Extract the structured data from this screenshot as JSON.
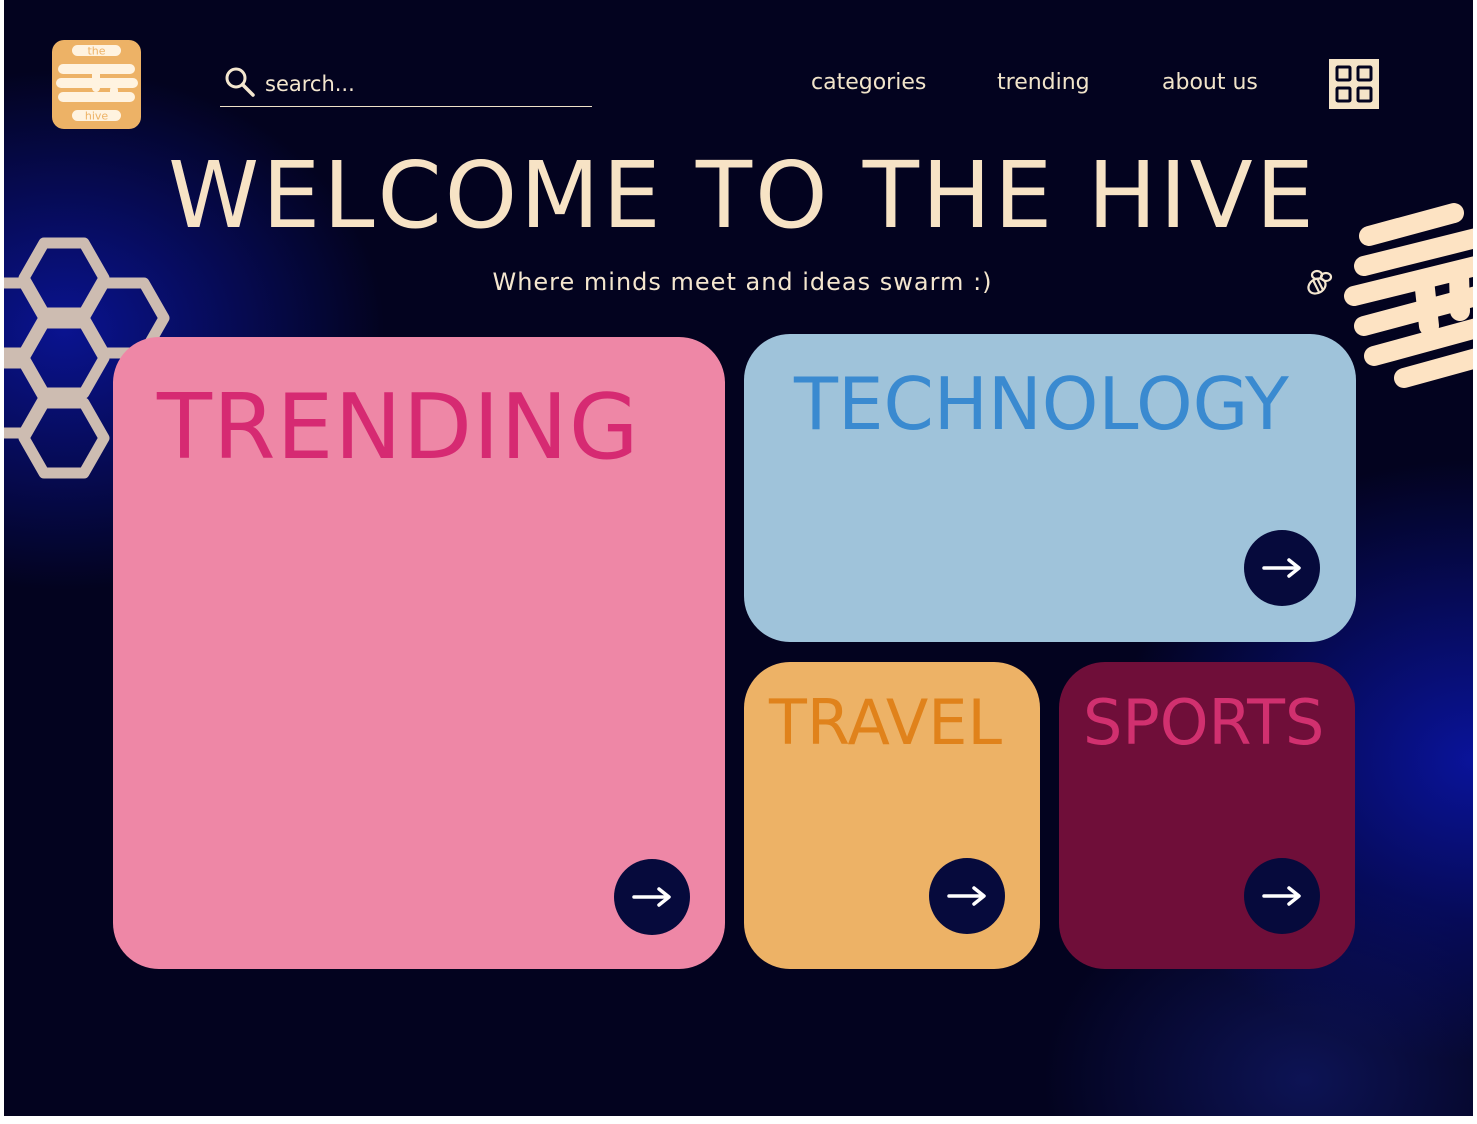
{
  "logo": {
    "top_text": "the",
    "bottom_text": "hive"
  },
  "search": {
    "placeholder": "search..."
  },
  "nav": {
    "items": [
      "categories",
      "trending",
      "about us"
    ]
  },
  "hero": {
    "title": "WELCOME TO THE HIVE",
    "subtitle": "Where minds meet and ideas swarm :)"
  },
  "cards": [
    {
      "title": "TRENDING",
      "background": "#ee87a6",
      "title_color": "#d62a72"
    },
    {
      "title": "TECHNOLOGY",
      "background": "#9fc3da",
      "title_color": "#3a8ad0"
    },
    {
      "title": "TRAVEL",
      "background": "#edb266",
      "title_color": "#e0821b"
    },
    {
      "title": "SPORTS",
      "background": "#6f0e39",
      "title_color": "#d1306f"
    }
  ],
  "icons": {
    "search": "search-icon",
    "menu": "grid-icon",
    "bee": "bee-icon",
    "arrow": "arrow-right-icon"
  },
  "colors": {
    "background": "#03031f",
    "accent_cream": "#f7e3c5",
    "logo_orange": "#edb266",
    "button_navy": "#060a3c"
  }
}
